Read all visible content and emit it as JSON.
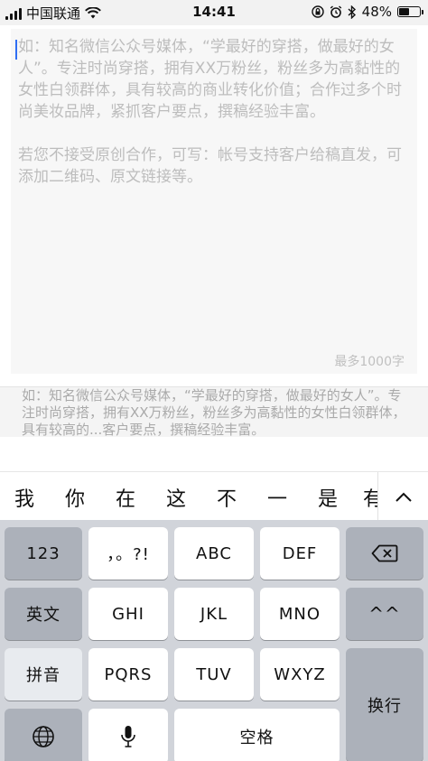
{
  "status_bar": {
    "carrier": "中国联通",
    "time": "14:41",
    "battery_percent": "48%",
    "battery_level": 0.48
  },
  "editor": {
    "placeholder": "如：知名微信公众号媒体，“学最好的穿搭，做最好的女人”。专注时尚穿搭，拥有XX万粉丝，粉丝多为高黏性的女性白领群体，具有较高的商业转化价值；合作过多个时尚美妆品牌，紧抓客户要点，撰稿经验丰富。\n\n若您不接受原创合作，可写：帐号支持客户给稿直发，可添加二维码、原文链接等。",
    "char_limit": "最多1000字"
  },
  "preview": {
    "text": "如：知名微信公众号媒体，“学最好的穿搭，做最好的女人”。专注时尚穿搭，拥有XX万粉丝，粉丝多为高黏性的女性白领群体，具有较高的...客户要点，撰稿经验丰富。"
  },
  "candidates": [
    "我",
    "你",
    "在",
    "这",
    "不",
    "一",
    "是",
    "有"
  ],
  "keyboard": {
    "row1": [
      "123",
      "，。?!",
      "ABC",
      "DEF"
    ],
    "row2": [
      "英文",
      "GHI",
      "JKL",
      "MNO",
      "^^"
    ],
    "row3": [
      "拼音",
      "PQRS",
      "TUV",
      "WXYZ"
    ],
    "enter": "换行",
    "space": "空格"
  },
  "colors": {
    "keyboard_bg": "#d1d4da",
    "key": "#ffffff",
    "func_key": "#acb1ba",
    "cursor": "#2f6ef3"
  }
}
